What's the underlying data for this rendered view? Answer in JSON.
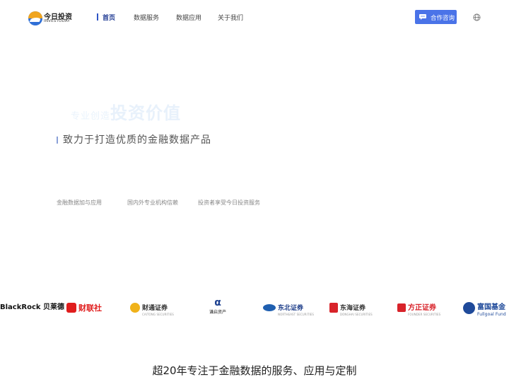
{
  "header": {
    "logo": {
      "cn": "今日投资",
      "en": "INVESTODAY"
    },
    "nav": [
      {
        "label": "首页",
        "active": true
      },
      {
        "label": "数据服务",
        "active": false
      },
      {
        "label": "数据应用",
        "active": false
      },
      {
        "label": "关于我们",
        "active": false
      }
    ],
    "consult_button": "合作咨询",
    "icons": {
      "consult": "chat-bubble-icon",
      "language": "globe-icon"
    },
    "accent_color": "#4a73e8"
  },
  "hero": {
    "faded_title_prefix": "专业创造",
    "faded_title_main": "投资价值",
    "subtitle": "致力于打造优质的金融数据产品",
    "features": [
      "金融数据加与应用",
      "国内外专业机构信赖",
      "投资者享受今日投资服务"
    ]
  },
  "partners": [
    {
      "name": "BlackRock 贝莱德",
      "icon": "blackrock-logo"
    },
    {
      "name": "财联社",
      "icon": "cls-logo"
    },
    {
      "name": "财通证券",
      "sub": "CAITONG SECURITIES",
      "icon": "caitong-logo"
    },
    {
      "name": "谦启资产",
      "icon": "qianqi-logo"
    },
    {
      "name": "东北证券",
      "sub": "NORTHEAST SECURITIES",
      "icon": "northeast-logo"
    },
    {
      "name": "东海证券",
      "sub": "DONGHAI SECURITIES",
      "icon": "donghai-logo"
    },
    {
      "name": "方正证券",
      "sub": "FOUNDER SECURITIES",
      "icon": "founder-logo"
    },
    {
      "name": "富国基金",
      "sub": "Fullgoal Fund",
      "icon": "fullgoal-logo"
    }
  ],
  "bottom_title": "超20年专注于金融数据的服务、应用与定制"
}
